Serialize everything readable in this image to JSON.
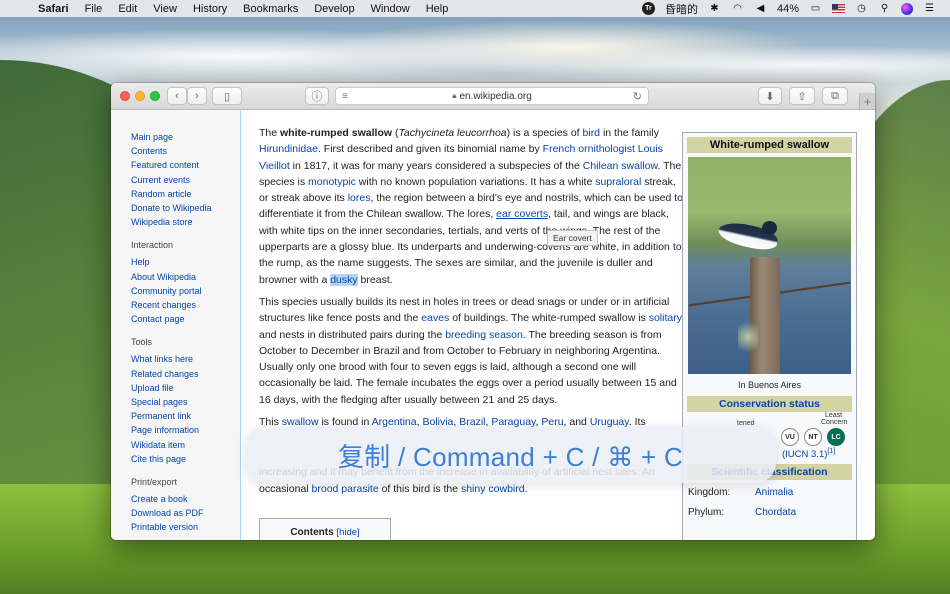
{
  "menubar": {
    "app_name": "Safari",
    "menus": [
      "File",
      "Edit",
      "View",
      "History",
      "Bookmarks",
      "Develop",
      "Window",
      "Help"
    ],
    "status": {
      "translate_label": "昏暗的",
      "battery": "44%"
    }
  },
  "browser": {
    "url": "en.wikipedia.org"
  },
  "sidebar": {
    "nav": [
      "Main page",
      "Contents",
      "Featured content",
      "Current events",
      "Random article",
      "Donate to Wikipedia",
      "Wikipedia store"
    ],
    "interaction_title": "Interaction",
    "interaction": [
      "Help",
      "About Wikipedia",
      "Community portal",
      "Recent changes",
      "Contact page"
    ],
    "tools_title": "Tools",
    "tools": [
      "What links here",
      "Related changes",
      "Upload file",
      "Special pages",
      "Permanent link",
      "Page information",
      "Wikidata item",
      "Cite this page"
    ],
    "print_title": "Print/export",
    "print": [
      "Create a book",
      "Download as PDF",
      "Printable version"
    ]
  },
  "article": {
    "p1": {
      "t1": "The ",
      "bold": "white-rumped swallow",
      "t2": " (",
      "ital": "Tachycineta leucorrhoa",
      "t3": ") is a species of ",
      "l_bird": "bird",
      "t4": " in the family ",
      "l_family": "Hirundinidae",
      "t5": ". First described and given its binomial name by ",
      "l_french": "French ornithologist Louis Vieillot",
      "t6": " in 1817, it was for many years considered a subspecies of the ",
      "l_chilean": "Chilean swallow",
      "t7": ". The species is ",
      "l_mono": "monotypic",
      "t8": " with no known population variations. It has a white ",
      "l_supra": "supraloral",
      "t9": " streak, or streak above its ",
      "l_lores": "lores",
      "t10": ", the region between a bird's eye and nostrils, which can be used to differentiate it from the Chilean swallow. The lores, ",
      "l_ear": "ear coverts",
      "t11": ", tail, and wings are black, with white tips on the inner secondaries, tertials, and ",
      "t11b": "verts of the wings. The rest of the upperparts are a glossy blue. Its underparts and underwing-coverts are white, in addition to the rump, as the name suggests. The sexes are similar, and the juvenile is duller and browner with a ",
      "l_dusky": "dusky",
      "t12": " breast."
    },
    "tooltip": "Ear covert",
    "p2": {
      "t1": "This species usually builds its nest in holes in trees or dead snags or under or in artificial structures like fence posts and the ",
      "l_eaves": "eaves",
      "t2": " of buildings. The white-rumped swallow is ",
      "l_solitary": "solitary",
      "t3": " and nests in distributed pairs during the ",
      "l_breeding": "breeding season",
      "t4": ". The breeding season is from October to December in Brazil and from October to February in neighboring Argentina. Usually only one brood with four to seven eggs is laid, although a second one will occasionally be laid. The female incubates the eggs over a period usually between 15 and 16 days, with the fledging after usually between 21 and 25 days."
    },
    "p3": {
      "t1": "This ",
      "l_swallow": "swallow",
      "t2": " is found in ",
      "l_argentina": "Argentina",
      "c1": ", ",
      "l_bolivia": "Bolivia",
      "c2": ", ",
      "l_brazil": "Brazil",
      "c3": ", ",
      "l_paraguay": "Paraguay",
      "c4": ", ",
      "l_peru": "Peru",
      "t3": ", and ",
      "l_uruguay": "Uruguay",
      "t4": ". Its"
    },
    "p4": {
      "t1": "increasing and it may benefit from the increase in availability of artificial nest sites. An occasional ",
      "l_parasite": "brood parasite",
      "t2": " of this bird is the ",
      "l_cowbird": "shiny cowbird",
      "t3": "."
    },
    "toc": {
      "title": "Contents",
      "hide": "[hide]"
    }
  },
  "infobox": {
    "title": "White-rumped swallow",
    "caption": "In Buenos Aires",
    "conservation_title": "Conservation status",
    "threatened_label": "tened",
    "least_label_1": "Least",
    "least_label_2": "Concern",
    "codes": [
      "VU",
      "NT",
      "LC"
    ],
    "iucn": "(IUCN 3.1)",
    "iucn_ref": "[1]",
    "classification_title": "Scientific classification",
    "kingdom_label": "Kingdom:",
    "kingdom_value": "Animalia",
    "phylum_label": "Phylum:",
    "phylum_value": "Chordata"
  },
  "hud": {
    "text": "复制 / Command + C / ⌘ + C"
  }
}
